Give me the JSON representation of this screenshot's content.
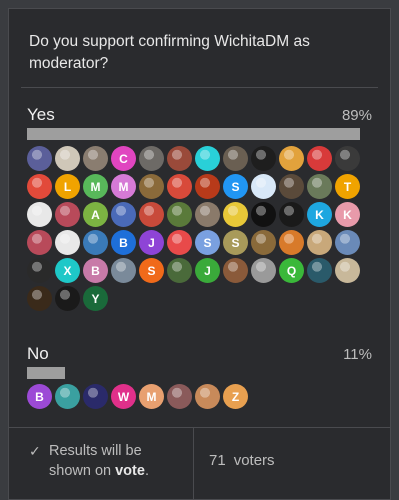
{
  "poll": {
    "question": "Do you support confirming WichitaDM as moderator?",
    "options": [
      {
        "label": "Yes",
        "percent": "89%",
        "fraction": 0.89,
        "voters": [
          {
            "letter": "",
            "color": "#5b5f9a"
          },
          {
            "letter": "",
            "color": "#cfc7b8"
          },
          {
            "letter": "",
            "color": "#8a7d70"
          },
          {
            "letter": "C",
            "color": "#e045c0"
          },
          {
            "letter": "",
            "color": "#6d6a66"
          },
          {
            "letter": "",
            "color": "#9a4a3a"
          },
          {
            "letter": "",
            "color": "#29d0d8"
          },
          {
            "letter": "",
            "color": "#6a5f52"
          },
          {
            "letter": "",
            "color": "#1e1e1e"
          },
          {
            "letter": "",
            "color": "#e2a23c"
          },
          {
            "letter": "",
            "color": "#d83a3a"
          },
          {
            "letter": "",
            "color": "#3a3a3a"
          },
          {
            "letter": "",
            "color": "#e24a3a"
          },
          {
            "letter": "L",
            "color": "#f0a300"
          },
          {
            "letter": "M",
            "color": "#58b85a"
          },
          {
            "letter": "M",
            "color": "#d67ad6"
          },
          {
            "letter": "",
            "color": "#8a6a3a"
          },
          {
            "letter": "",
            "color": "#d84a3a"
          },
          {
            "letter": "",
            "color": "#b83a1a"
          },
          {
            "letter": "S",
            "color": "#2196f3"
          },
          {
            "letter": "",
            "color": "#d8e8f8"
          },
          {
            "letter": "",
            "color": "#5a4a3a"
          },
          {
            "letter": "",
            "color": "#6a7a5a"
          },
          {
            "letter": "T",
            "color": "#f0a300"
          },
          {
            "letter": "",
            "color": "#e8e8e8"
          },
          {
            "letter": "",
            "color": "#b84a5a"
          },
          {
            "letter": "A",
            "color": "#7cb342"
          },
          {
            "letter": "",
            "color": "#4a6ab8"
          },
          {
            "letter": "",
            "color": "#c84a3a"
          },
          {
            "letter": "",
            "color": "#5a7a3a"
          },
          {
            "letter": "",
            "color": "#8a7a6a"
          },
          {
            "letter": "",
            "color": "#e8c838"
          },
          {
            "letter": "",
            "color": "#111111"
          },
          {
            "letter": "",
            "color": "#1a1a1a"
          },
          {
            "letter": "K",
            "color": "#1ea7e0"
          },
          {
            "letter": "K",
            "color": "#e89aaa"
          },
          {
            "letter": "",
            "color": "#b84a5a"
          },
          {
            "letter": "",
            "color": "#e8e8e8"
          },
          {
            "letter": "",
            "color": "#3a7ab8"
          },
          {
            "letter": "B",
            "color": "#1e6fd9"
          },
          {
            "letter": "J",
            "color": "#8e44d6"
          },
          {
            "letter": "",
            "color": "#e84a4a"
          },
          {
            "letter": "S",
            "color": "#7aa0e0"
          },
          {
            "letter": "S",
            "color": "#a89a5a"
          },
          {
            "letter": "",
            "color": "#8a6a3a"
          },
          {
            "letter": "",
            "color": "#d87a2a"
          },
          {
            "letter": "",
            "color": "#c8a87a"
          },
          {
            "letter": "",
            "color": "#6a8ab8"
          },
          {
            "letter": "",
            "color": "#2a2a2a"
          },
          {
            "letter": "X",
            "color": "#1ec8c8"
          },
          {
            "letter": "B",
            "color": "#c87aa8"
          },
          {
            "letter": "",
            "color": "#7a8a9a"
          },
          {
            "letter": "S",
            "color": "#f06a1a"
          },
          {
            "letter": "",
            "color": "#4a6a3a"
          },
          {
            "letter": "J",
            "color": "#3aaa3a"
          },
          {
            "letter": "",
            "color": "#8a5a3a"
          },
          {
            "letter": "",
            "color": "#9a9a9a"
          },
          {
            "letter": "Q",
            "color": "#3ab83a"
          },
          {
            "letter": "",
            "color": "#2a5a6a"
          },
          {
            "letter": "",
            "color": "#c8b89a"
          },
          {
            "letter": "",
            "color": "#3a2a1a"
          },
          {
            "letter": "",
            "color": "#1a1a1a"
          },
          {
            "letter": "Y",
            "color": "#1a6a3a"
          }
        ]
      },
      {
        "label": "No",
        "percent": "11%",
        "fraction": 0.11,
        "voters": [
          {
            "letter": "B",
            "color": "#9c4ad6"
          },
          {
            "letter": "",
            "color": "#3aa0a0"
          },
          {
            "letter": "",
            "color": "#2a2a6a"
          },
          {
            "letter": "W",
            "color": "#e0308a"
          },
          {
            "letter": "M",
            "color": "#e8a070"
          },
          {
            "letter": "",
            "color": "#8a5a5a"
          },
          {
            "letter": "",
            "color": "#c88a5a"
          },
          {
            "letter": "Z",
            "color": "#e8a050"
          }
        ]
      }
    ],
    "footer": {
      "results_prefix": "Results will be shown on ",
      "results_bold": "vote",
      "results_suffix": ".",
      "voters_count": "71",
      "voters_label": "voters"
    }
  }
}
